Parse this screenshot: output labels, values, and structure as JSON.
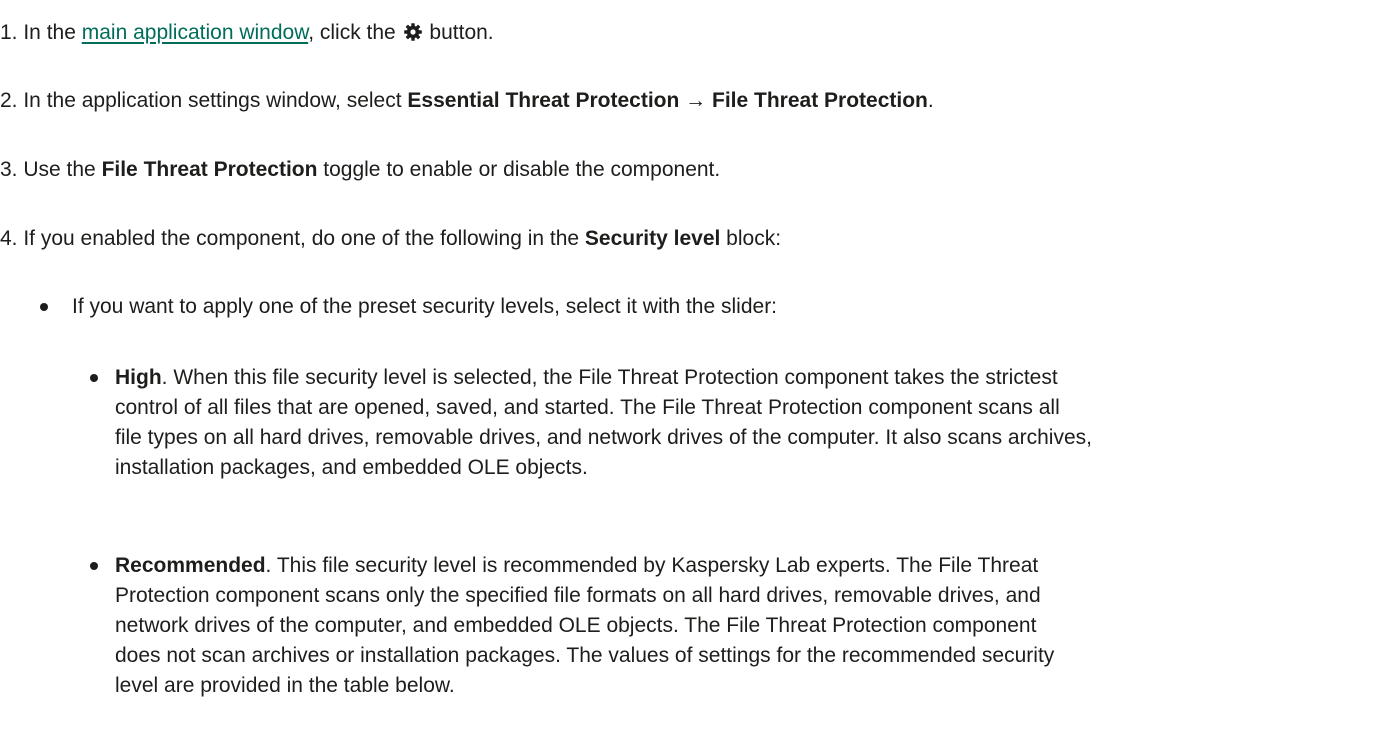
{
  "steps": [
    {
      "number": "1.",
      "pre": " In the ",
      "link": "main application window",
      "mid": ", click the ",
      "icon": "gear-icon",
      "post": " button."
    },
    {
      "number": "2.",
      "pre": " In the application settings window, select ",
      "bold1": "Essential Threat Protection",
      "arrow": " → ",
      "bold2": "File Threat Protection",
      "post": "."
    },
    {
      "number": "3.",
      "pre": " Use the ",
      "bold": "File Threat Protection",
      "post": " toggle to enable or disable the component."
    },
    {
      "number": "4.",
      "pre": " If you enabled the component, do one of the following in the ",
      "bold": "Security level",
      "post": " block:"
    }
  ],
  "sub_item": {
    "text": "If you want to apply one of the preset security levels, select it with the slider:"
  },
  "levels": [
    {
      "name": "High",
      "lines": [
        ". When this file security level is selected, the File Threat Protection component takes the strictest",
        "control of all files that are opened, saved, and started. The File Threat Protection component scans all",
        "file types on all hard drives, removable drives, and network drives of the computer. It also scans archives,",
        "installation packages, and embedded OLE objects."
      ]
    },
    {
      "name": "Recommended",
      "lines": [
        ". This file security level is recommended by Kaspersky Lab experts. The File Threat",
        "Protection component scans only the specified file formats on all hard drives, removable drives, and",
        "network drives of the computer, and embedded OLE objects. The File Threat Protection component",
        "does not scan archives or installation packages. The values of settings for the recommended security",
        "level are provided in the table below."
      ]
    }
  ],
  "colors": {
    "text": "#1d1d1b",
    "link": "#006d5b"
  }
}
